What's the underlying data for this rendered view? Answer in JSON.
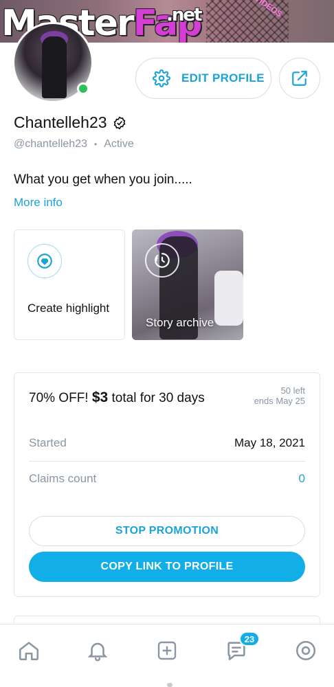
{
  "cover": {
    "watermark_main": "Master",
    "watermark_accent": "Fap",
    "watermark_suffix": ".net",
    "cover_text": "VIDEOS"
  },
  "profile": {
    "name": "Chantelleh23",
    "handle": "@chantelleh23",
    "separator": "•",
    "status": "Active",
    "bio": "What you get when you join.....",
    "more_info": "More info"
  },
  "actions": {
    "edit_profile": "EDIT PROFILE"
  },
  "highlights": {
    "create_label": "Create highlight",
    "archive_label": "Story archive"
  },
  "promotion": {
    "discount": "70% OFF!",
    "price": "$3",
    "duration": "total for 30 days",
    "left": "50 left",
    "ends": "ends May 25",
    "started_label": "Started",
    "started_value": "May 18, 2021",
    "claims_label": "Claims count",
    "claims_value": "0",
    "stop_button": "STOP PROMOTION",
    "copy_button": "COPY LINK TO PROFILE"
  },
  "nav": {
    "messages_badge": "23",
    "items": [
      "home-icon",
      "bell-icon",
      "plus-square-icon",
      "messages-icon",
      "profile-icon"
    ]
  },
  "colors": {
    "accent": "#12aee8",
    "link": "#1ba3d8",
    "online": "#2ec15a",
    "muted": "#8a96a3"
  }
}
